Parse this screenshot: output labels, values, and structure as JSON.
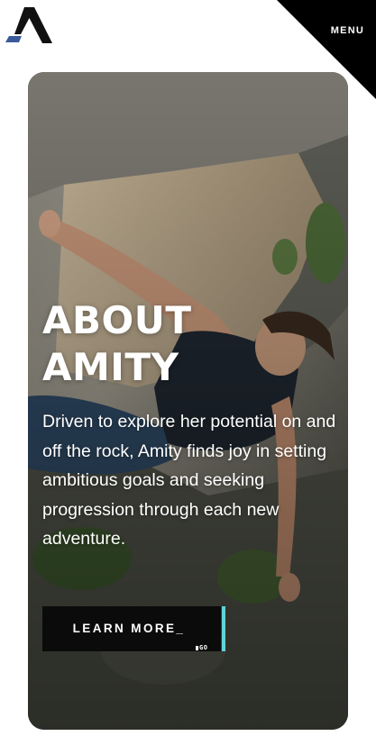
{
  "header": {
    "logo_name": "brand-logo",
    "menu_label": "MENU"
  },
  "hero": {
    "title_line1": "ABOUT",
    "title_line2": "AMITY",
    "body": "Driven to explore her potential on and off the rock, Amity finds joy in setting ambitious goals and seeking progression through each new adventure.",
    "cta_label": "LEARN MORE_",
    "cta_tag": "GO"
  },
  "colors": {
    "logo_dark": "#111111",
    "logo_blue": "#3b5a9a",
    "menu_bg": "#000000",
    "cta_bg": "#0b0b0b",
    "cta_accent": "#5fd3d8",
    "text": "#ffffff"
  },
  "icons": {
    "logo": "amity-logo-icon",
    "background": "climber-photo"
  }
}
